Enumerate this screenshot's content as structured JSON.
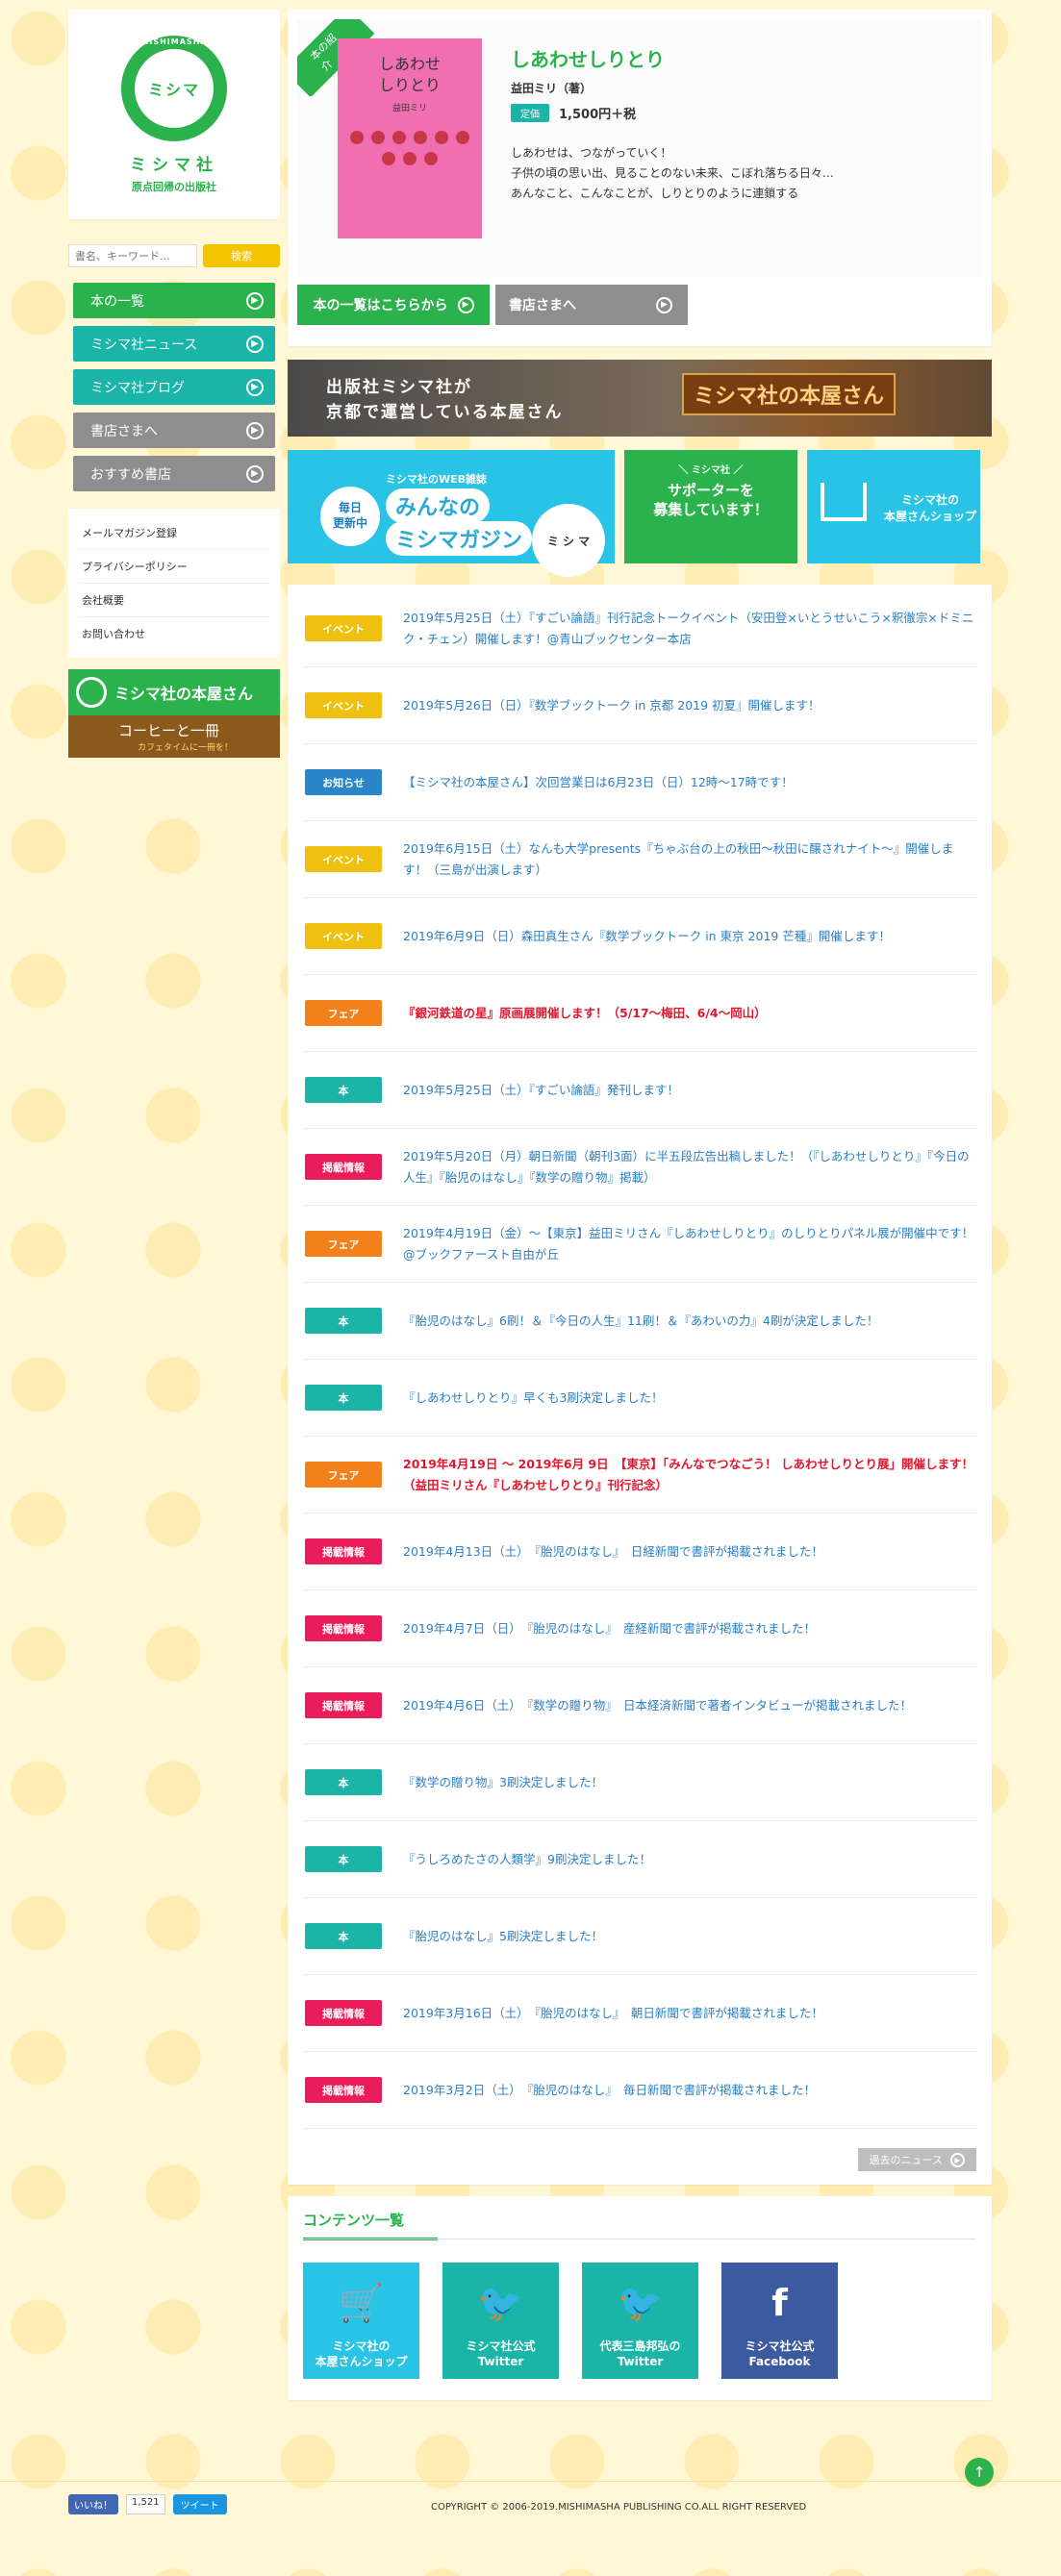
{
  "logo": {
    "ring_text": "MISHIMASHA",
    "center": "ミシマ",
    "name": "ミシマ社",
    "tagline": "原点回帰の出版社"
  },
  "search": {
    "placeholder": "書名、キーワード…",
    "button": "検索"
  },
  "nav": [
    {
      "label": "本の一覧",
      "color": "#2bb24c"
    },
    {
      "label": "ミシマ社ニュース",
      "color": "#1ab5a8"
    },
    {
      "label": "ミシマ社ブログ",
      "color": "#1ab5a8"
    },
    {
      "label": "書店さまへ",
      "color": "#8e8e8e"
    },
    {
      "label": "おすすめ書店",
      "color": "#8e8e8e"
    }
  ],
  "sub_links": [
    "メールマガジン登録",
    "プライバシーポリシー",
    "会社概要",
    "お問い合わせ"
  ],
  "side_banners": {
    "shop": "ミシマ社の本屋さん",
    "coffee": "コーヒーと一冊",
    "coffee_sub": "カフェタイムに一冊を！"
  },
  "feature": {
    "ribbon": "本の紹介",
    "cover_title": "しあわせ\nしりとり",
    "cover_author": "益田ミリ",
    "title": "しあわせしりとり",
    "author": "益田ミリ（著）",
    "price_label": "定価",
    "price": "1,500円＋税",
    "desc": [
      "しあわせは、つながっていく！",
      "子供の頃の思い出、見ることのない未来、こぼれ落ちる日々…",
      "あんなこと、こんなことが、しりとりのように連鎖する"
    ],
    "btn_books": "本の一覧はこちらから",
    "btn_stores": "書店さまへ"
  },
  "photo_banner": {
    "line1": "出版社ミシマ社が",
    "line2": "京都で運営している本屋さん",
    "sign": "ミシマ社の本屋さん"
  },
  "promos": {
    "magazine_badge": "毎日\n更新中",
    "magazine_small": "ミシマ社のWEB雑誌",
    "magazine_line1": "みんなの",
    "magazine_line2": "ミシマガジン",
    "magazine_face": "ミ シ マ",
    "supporter_small": "＼ ミシマ社 ／",
    "supporter_line": "サポーターを\n募集しています！",
    "shop": "ミシマ社の\n本屋さんショップ"
  },
  "category_colors": {
    "イベント": "#f0c010",
    "お知らせ": "#2a86c8",
    "フェア": "#f2801b",
    "本": "#1ab5a8",
    "掲載情報": "#ea1c5a"
  },
  "news": [
    {
      "cat": "イベント",
      "text": "2019年5月25日（土）『すごい論語』刊行記念トークイベント（安田登×いとうせいこう×釈徹宗×ドミニク・チェン）開催します！@青山ブックセンター本店",
      "red": false
    },
    {
      "cat": "イベント",
      "text": "2019年5月26日（日）『数学ブックトーク in 京都 2019 初夏』開催します！",
      "red": false
    },
    {
      "cat": "お知らせ",
      "text": "【ミシマ社の本屋さん】次回営業日は6月23日（日）12時〜17時です！",
      "red": false
    },
    {
      "cat": "イベント",
      "text": "2019年6月15日（土）なんも大学presents『ちゃぶ台の上の秋田〜秋田に醸されナイト〜』開催します！（三島が出演します）",
      "red": false
    },
    {
      "cat": "イベント",
      "text": "2019年6月9日（日）森田真生さん『数学ブックトーク in 東京 2019 芒種』開催します！",
      "red": false
    },
    {
      "cat": "フェア",
      "text": "『銀河鉄道の星』原画展開催します！（5/17〜梅田、6/4〜岡山）",
      "red": true
    },
    {
      "cat": "本",
      "text": "2019年5月25日（土）『すごい論語』発刊します！",
      "red": false
    },
    {
      "cat": "掲載情報",
      "text": "2019年5月20日（月）朝日新聞（朝刊3面）に半五段広告出稿しました！（『しあわせしりとり』『今日の人生』『胎児のはなし』『数学の贈り物』掲載）",
      "red": false
    },
    {
      "cat": "フェア",
      "text": "2019年4月19日（金）〜【東京】益田ミリさん『しあわせしりとり』のしりとりパネル展が開催中です！@ブックファースト自由が丘",
      "red": false
    },
    {
      "cat": "本",
      "text": "『胎児のはなし』6刷！＆『今日の人生』11刷！＆『あわいの力』4刷が決定しました！",
      "red": false
    },
    {
      "cat": "本",
      "text": "『しあわせしりとり』早くも3刷決定しました！",
      "red": false
    },
    {
      "cat": "フェア",
      "text": "2019年4月19日 〜 2019年6月 9日　【東京】「みんなでつなごう！ しあわせしりとり展」開催します！（益田ミリさん『しあわせしりとり』刊行記念）",
      "red": true
    },
    {
      "cat": "掲載情報",
      "text": "2019年4月13日（土）　『胎児のはなし』　日経新聞で書評が掲載されました！",
      "red": false
    },
    {
      "cat": "掲載情報",
      "text": "2019年4月7日（日）　『胎児のはなし』　産経新聞で書評が掲載されました！",
      "red": false
    },
    {
      "cat": "掲載情報",
      "text": "2019年4月6日（土）　『数学の贈り物』　日本経済新聞で著者インタビューが掲載されました！",
      "red": false
    },
    {
      "cat": "本",
      "text": "『数学の贈り物』3刷決定しました！",
      "red": false
    },
    {
      "cat": "本",
      "text": "『うしろめたさの人類学』9刷決定しました！",
      "red": false
    },
    {
      "cat": "本",
      "text": "『胎児のはなし』5刷決定しました！",
      "red": false
    },
    {
      "cat": "掲載情報",
      "text": "2019年3月16日（土）　『胎児のはなし』　朝日新聞で書評が掲載されました！",
      "red": false
    },
    {
      "cat": "掲載情報",
      "text": "2019年3月2日（土）　『胎児のはなし』　毎日新聞で書評が掲載されました！",
      "red": false
    }
  ],
  "news_more": "過去のニュース",
  "contents": {
    "heading": "コンテンツ一覧",
    "tiles": [
      {
        "label": "ミシマ社の\n本屋さんショップ",
        "icon": "cart-icon",
        "glyph": "🛒",
        "color": "#29c3e6"
      },
      {
        "label": "ミシマ社公式\nTwitter",
        "icon": "twitter-icon",
        "glyph": "🐦",
        "color": "#1ab5a8"
      },
      {
        "label": "代表三島邦弘の\nTwitter",
        "icon": "twitter-icon",
        "glyph": "🐦",
        "color": "#1ab5a8"
      },
      {
        "label": "ミシマ社公式\nFacebook",
        "icon": "facebook-icon",
        "glyph": "f",
        "color": "#3b5aa0"
      }
    ]
  },
  "footer": {
    "like": "いいね！",
    "like_count": "1,521",
    "tweet": "ツイート",
    "copyright": "COPYRIGHT © 2006-2019.MISHIMASHA PUBLISHING CO.ALL RIGHT RESERVED"
  }
}
